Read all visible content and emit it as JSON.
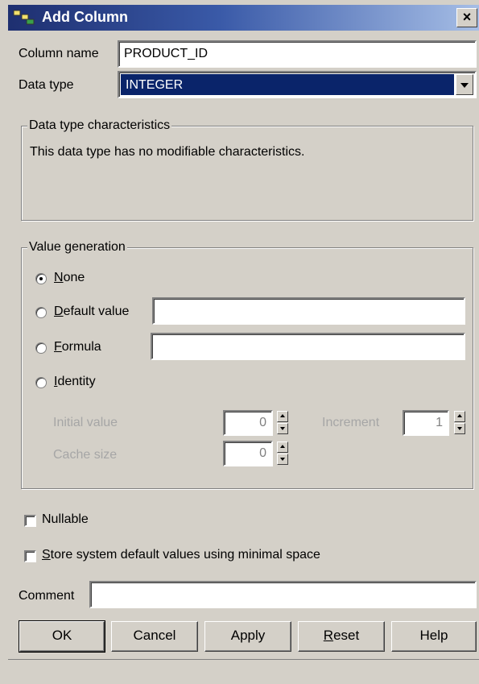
{
  "window": {
    "title": "Add Column",
    "close_label": "×"
  },
  "column_name": {
    "label": "Column name",
    "value": "PRODUCT_ID"
  },
  "data_type": {
    "label": "Data type",
    "value": "INTEGER"
  },
  "characteristics": {
    "legend": "Data type characteristics",
    "text": "This data type has no modifiable characteristics."
  },
  "value_generation": {
    "legend": "Value generation",
    "options": {
      "none": {
        "label": "None",
        "checked": true
      },
      "default_value": {
        "label": "Default value",
        "value": ""
      },
      "formula": {
        "label": "Formula",
        "value": ""
      },
      "identity": {
        "label": "Identity"
      }
    },
    "identity_fields": {
      "initial_value": {
        "label": "Initial value",
        "value": "0"
      },
      "increment": {
        "label": "Increment",
        "value": "1"
      },
      "cache_size": {
        "label": "Cache size",
        "value": "0"
      }
    }
  },
  "nullable": {
    "label": "Nullable",
    "checked": false
  },
  "store_minimal": {
    "label": "Store system default values using minimal space",
    "checked": false
  },
  "comment": {
    "label": "Comment",
    "value": ""
  },
  "buttons": {
    "ok": "OK",
    "cancel": "Cancel",
    "apply": "Apply",
    "reset": "Reset",
    "help": "Help"
  }
}
